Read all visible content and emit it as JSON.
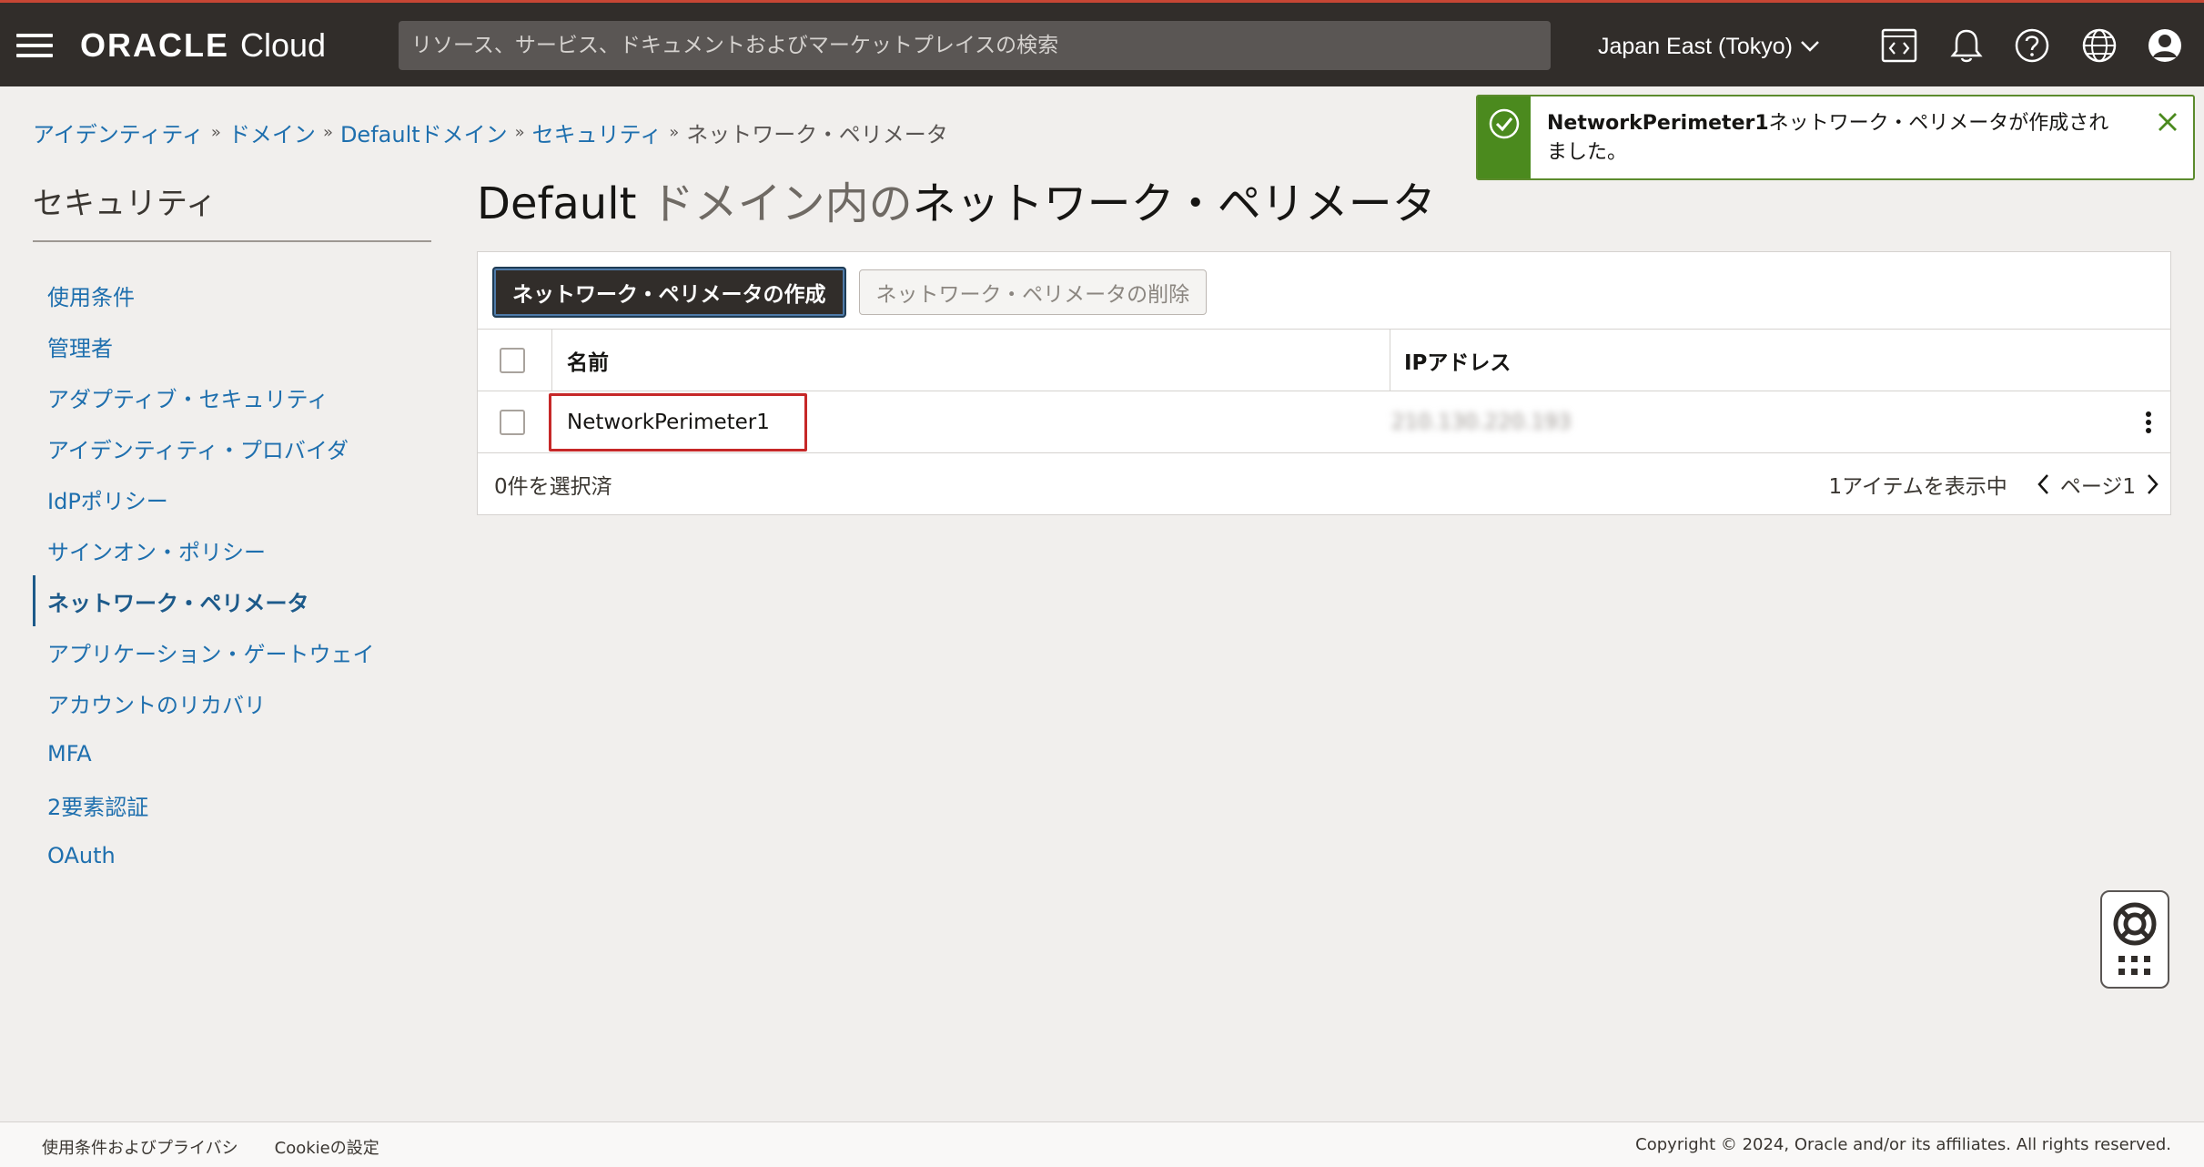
{
  "header": {
    "logo_oracle": "ORACLE",
    "logo_cloud": "Cloud",
    "search_placeholder": "リソース、サービス、ドキュメントおよびマーケットプレイスの検索",
    "region": "Japan East (Tokyo)",
    "colors": {
      "bar": "#312d2a",
      "accent": "#c74634"
    }
  },
  "breadcrumb": {
    "items": [
      "アイデンティティ",
      "ドメイン",
      "Defaultドメイン",
      "セキュリティ"
    ],
    "separator": "»",
    "current": "ネットワーク・ペリメータ"
  },
  "sidebar": {
    "title": "セキュリティ",
    "items": [
      {
        "label": "使用条件"
      },
      {
        "label": "管理者"
      },
      {
        "label": "アダプティブ・セキュリティ"
      },
      {
        "label": "アイデンティティ・プロバイダ"
      },
      {
        "label": "IdPポリシー"
      },
      {
        "label": "サインオン・ポリシー"
      },
      {
        "label": "ネットワーク・ペリメータ",
        "active": true
      },
      {
        "label": "アプリケーション・ゲートウェイ"
      },
      {
        "label": "アカウントのリカバリ"
      },
      {
        "label": "MFA"
      },
      {
        "label": "2要素認証"
      },
      {
        "label": "OAuth"
      }
    ]
  },
  "main": {
    "title_prefix": "Default",
    "title_muted": " ドメイン内の",
    "title_suffix": "ネットワーク・ペリメータ",
    "create_button": "ネットワーク・ペリメータの作成",
    "delete_button": "ネットワーク・ペリメータの削除",
    "columns": [
      "名前",
      "IPアドレス"
    ],
    "rows": [
      {
        "name": "NetworkPerimeter1",
        "ip": "210.130.220.193"
      }
    ],
    "selected_count": "0件を選択済",
    "items_shown": "1アイテムを表示中",
    "page_label": "ページ1"
  },
  "toast": {
    "name": "NetworkPerimeter1",
    "message": "ネットワーク・ペリメータが作成されました。",
    "color": "#4b8a1e"
  },
  "footer": {
    "terms": "使用条件およびプライバシ",
    "cookies": "Cookieの設定",
    "copyright": "Copyright © 2024, Oracle and/or its affiliates. All rights reserved."
  }
}
